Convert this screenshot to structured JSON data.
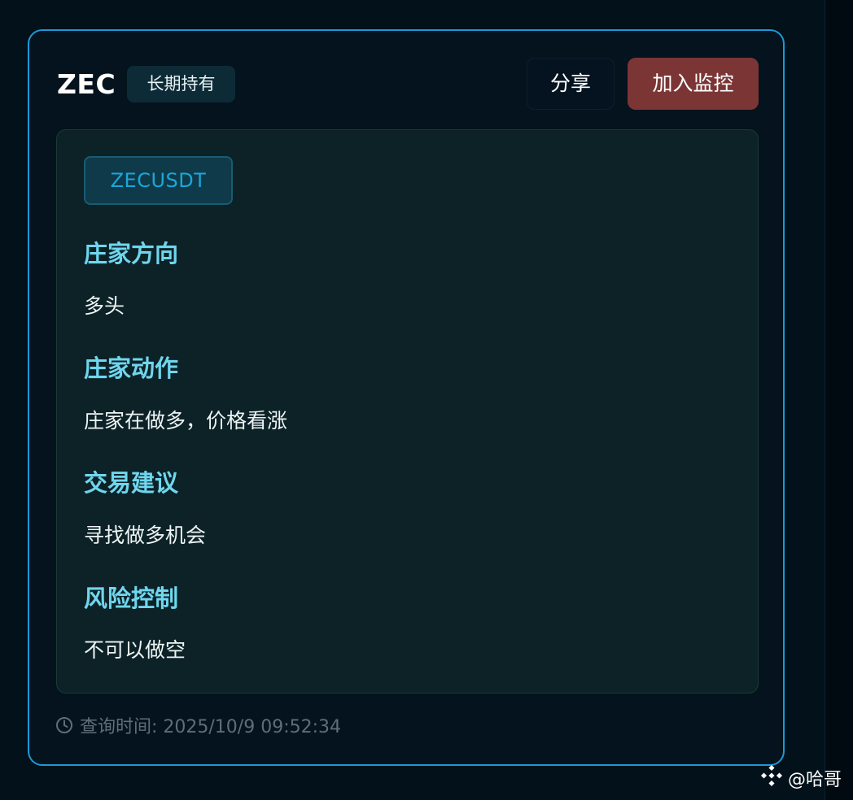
{
  "card": {
    "symbol": "ZEC",
    "badge": "长期持有",
    "share_label": "分享",
    "monitor_label": "加入监控"
  },
  "panel": {
    "pair": "ZECUSDT",
    "sections": [
      {
        "title": "庄家方向",
        "text": "多头"
      },
      {
        "title": "庄家动作",
        "text": "庄家在做多，价格看涨"
      },
      {
        "title": "交易建议",
        "text": "寻找做多机会"
      },
      {
        "title": "风险控制",
        "text": "不可以做空"
      }
    ]
  },
  "footer": {
    "query_time": "查询时间: 2025/10/9 09:52:34",
    "icon": "clock-icon"
  },
  "watermark": {
    "text": "@哈哥",
    "icon": "binance-logo-icon"
  },
  "colors": {
    "accent_border": "#1a9ad6",
    "section_title": "#6fd6ee",
    "monitor_button": "#7c3535",
    "pair_tag_text": "#18a8da"
  }
}
